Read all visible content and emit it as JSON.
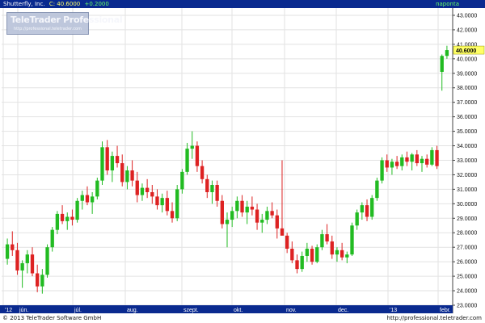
{
  "header": {
    "instrument": "Shutterfly, Inc.",
    "close_label": "C: 40.6000",
    "change_label": "+0.2000",
    "period": "naponta"
  },
  "watermark": {
    "title": "TeleTrader Professional",
    "url": "http://professional.teletrader.com"
  },
  "footer": {
    "copyright": "© 2013 TeleTrader Software GmbH",
    "url": "http://professional.teletrader.com"
  },
  "colors": {
    "up": "#22bb22",
    "down": "#dd2222",
    "axis_bg": "#0a2a8f",
    "price_marker": "#ffff66",
    "grid": "#e2e2e2"
  },
  "chart_data": {
    "type": "candlestick",
    "title": "Shutterfly, Inc.",
    "ylim": [
      23.0,
      43.5
    ],
    "y_ticks": [
      "23.0000",
      "24.0000",
      "25.0000",
      "26.0000",
      "27.0000",
      "28.0000",
      "29.0000",
      "30.0000",
      "31.0000",
      "32.0000",
      "33.0000",
      "34.0000",
      "35.0000",
      "36.0000",
      "37.0000",
      "38.0000",
      "39.0000",
      "40.0000",
      "41.0000",
      "42.0000",
      "43.0000"
    ],
    "x_labels": [
      "'12",
      "jún.",
      "júl.",
      "aug.",
      "szept.",
      "okt.",
      "nov.",
      "dec.",
      "'13",
      "febr."
    ],
    "last_price": "40.6000",
    "grid": true,
    "legend": "none",
    "candles": [
      [
        26.2,
        27.6,
        25.8,
        27.2
      ],
      [
        27.2,
        28.1,
        26.4,
        26.8
      ],
      [
        26.8,
        27.3,
        25.1,
        25.4
      ],
      [
        25.4,
        26.1,
        24.2,
        25.9
      ],
      [
        25.9,
        26.8,
        25.2,
        26.5
      ],
      [
        26.5,
        27.0,
        25.0,
        25.2
      ],
      [
        25.2,
        25.8,
        23.9,
        24.3
      ],
      [
        24.3,
        25.5,
        23.8,
        25.1
      ],
      [
        25.1,
        27.2,
        24.9,
        27.0
      ],
      [
        27.0,
        28.4,
        26.7,
        28.2
      ],
      [
        28.2,
        29.5,
        27.9,
        29.3
      ],
      [
        29.3,
        29.9,
        28.6,
        28.8
      ],
      [
        28.8,
        29.4,
        28.2,
        29.1
      ],
      [
        29.1,
        29.6,
        28.5,
        28.9
      ],
      [
        28.9,
        30.4,
        28.7,
        30.2
      ],
      [
        30.2,
        30.9,
        29.6,
        30.6
      ],
      [
        30.6,
        31.2,
        29.9,
        30.1
      ],
      [
        30.1,
        30.8,
        29.3,
        30.5
      ],
      [
        30.5,
        31.8,
        30.3,
        31.6
      ],
      [
        31.6,
        34.3,
        31.3,
        33.9
      ],
      [
        33.9,
        34.4,
        32.0,
        32.3
      ],
      [
        32.3,
        33.6,
        31.5,
        33.3
      ],
      [
        33.3,
        34.0,
        32.5,
        32.8
      ],
      [
        32.8,
        33.4,
        31.2,
        31.5
      ],
      [
        31.5,
        32.6,
        31.0,
        32.3
      ],
      [
        32.3,
        33.0,
        31.2,
        31.6
      ],
      [
        31.6,
        32.2,
        30.1,
        30.6
      ],
      [
        30.6,
        31.4,
        30.2,
        31.1
      ],
      [
        31.1,
        31.7,
        30.4,
        30.8
      ],
      [
        30.8,
        31.3,
        30.0,
        30.5
      ],
      [
        30.5,
        31.0,
        29.6,
        29.9
      ],
      [
        29.9,
        30.7,
        29.4,
        30.4
      ],
      [
        30.4,
        30.9,
        29.2,
        29.5
      ],
      [
        29.5,
        30.1,
        28.7,
        29.0
      ],
      [
        29.0,
        31.3,
        28.8,
        31.0
      ],
      [
        31.0,
        32.4,
        30.7,
        32.2
      ],
      [
        32.2,
        34.2,
        32.0,
        33.8
      ],
      [
        33.8,
        35.0,
        33.1,
        34.0
      ],
      [
        34.0,
        34.3,
        32.2,
        32.6
      ],
      [
        32.6,
        33.0,
        31.4,
        31.7
      ],
      [
        31.7,
        32.0,
        30.4,
        30.8
      ],
      [
        30.8,
        31.6,
        30.0,
        31.3
      ],
      [
        31.3,
        31.6,
        29.8,
        30.2
      ],
      [
        30.2,
        30.6,
        28.3,
        28.6
      ],
      [
        28.6,
        29.4,
        27.0,
        28.9
      ],
      [
        28.9,
        29.8,
        28.4,
        29.5
      ],
      [
        29.5,
        30.5,
        29.0,
        30.2
      ],
      [
        30.2,
        30.6,
        29.1,
        29.4
      ],
      [
        29.4,
        30.2,
        28.6,
        29.8
      ],
      [
        29.8,
        30.5,
        29.2,
        29.6
      ],
      [
        29.6,
        30.0,
        28.2,
        28.7
      ],
      [
        28.7,
        29.3,
        28.0,
        28.9
      ],
      [
        28.9,
        29.8,
        28.6,
        29.5
      ],
      [
        29.5,
        30.1,
        29.0,
        29.2
      ],
      [
        29.2,
        29.6,
        27.6,
        28.3
      ],
      [
        28.3,
        33.0,
        28.0,
        27.8
      ],
      [
        27.8,
        28.0,
        26.6,
        26.9
      ],
      [
        26.9,
        27.4,
        25.9,
        26.1
      ],
      [
        26.1,
        26.5,
        25.2,
        25.5
      ],
      [
        25.5,
        26.7,
        25.3,
        26.4
      ],
      [
        26.4,
        27.3,
        26.0,
        26.9
      ],
      [
        26.9,
        27.1,
        25.8,
        26.0
      ],
      [
        26.0,
        27.2,
        25.9,
        27.0
      ],
      [
        27.0,
        28.2,
        26.8,
        27.9
      ],
      [
        27.9,
        28.6,
        27.2,
        27.4
      ],
      [
        27.4,
        27.8,
        26.2,
        26.5
      ],
      [
        26.5,
        27.0,
        26.0,
        26.8
      ],
      [
        26.8,
        27.3,
        26.1,
        26.3
      ],
      [
        26.3,
        26.7,
        25.9,
        26.5
      ],
      [
        26.5,
        28.7,
        26.4,
        28.5
      ],
      [
        28.5,
        29.6,
        28.2,
        29.4
      ],
      [
        29.4,
        30.1,
        28.9,
        29.9
      ],
      [
        29.9,
        30.3,
        28.8,
        29.1
      ],
      [
        29.1,
        30.6,
        28.9,
        30.4
      ],
      [
        30.4,
        31.8,
        30.2,
        31.6
      ],
      [
        31.6,
        33.2,
        31.4,
        33.0
      ],
      [
        33.0,
        33.4,
        32.2,
        32.5
      ],
      [
        32.5,
        33.1,
        32.0,
        32.9
      ],
      [
        32.9,
        33.3,
        32.4,
        32.6
      ],
      [
        32.6,
        33.4,
        32.3,
        33.2
      ],
      [
        33.2,
        33.6,
        32.6,
        32.9
      ],
      [
        32.9,
        33.5,
        32.3,
        33.4
      ],
      [
        33.4,
        33.7,
        32.6,
        32.8
      ],
      [
        32.8,
        33.3,
        32.2,
        33.1
      ],
      [
        33.1,
        33.4,
        32.5,
        32.7
      ],
      [
        32.7,
        33.9,
        32.6,
        33.7
      ],
      [
        33.7,
        34.0,
        32.4,
        32.6
      ],
      [
        39.1,
        40.3,
        37.8,
        40.2
      ],
      [
        40.2,
        40.9,
        40.0,
        40.6
      ]
    ]
  }
}
